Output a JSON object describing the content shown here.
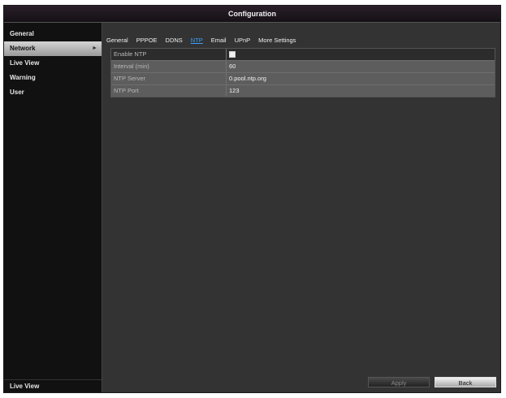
{
  "window": {
    "title": "Configuration"
  },
  "sidebar": {
    "items": [
      {
        "label": "General"
      },
      {
        "label": "Network"
      },
      {
        "label": "Live View"
      },
      {
        "label": "Warning"
      },
      {
        "label": "User"
      }
    ],
    "active_index": 1,
    "footer_label": "Live View"
  },
  "tabs": [
    {
      "label": "General"
    },
    {
      "label": "PPPOE"
    },
    {
      "label": "DDNS"
    },
    {
      "label": "NTP"
    },
    {
      "label": "Email"
    },
    {
      "label": "UPnP"
    },
    {
      "label": "More Settings"
    }
  ],
  "active_tab": "NTP",
  "ntp": {
    "enable_label": "Enable NTP",
    "enable_checked": false,
    "interval_label": "Interval (min)",
    "interval_value": "60",
    "server_label": "NTP Server",
    "server_value": "0.pool.ntp.org",
    "port_label": "NTP Port",
    "port_value": "123"
  },
  "buttons": {
    "apply": "Apply",
    "back": "Back"
  },
  "colors": {
    "active_tab": "#3aa0ff",
    "background": "#333333",
    "sidebar": "#111111"
  }
}
